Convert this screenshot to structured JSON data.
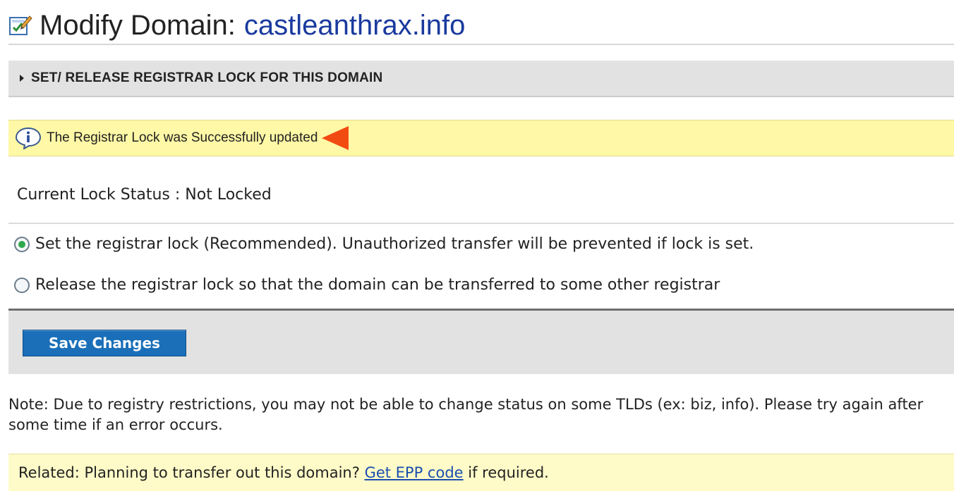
{
  "header": {
    "title_prefix": "Modify Domain:",
    "domain": "castleanthrax.info",
    "icon": "edit-document-icon"
  },
  "section": {
    "title": "SET/ RELEASE REGISTRAR LOCK FOR THIS DOMAIN"
  },
  "message": {
    "text": "The Registrar Lock was Successfully updated",
    "icon": "info-bubble-icon",
    "pointer_color": "#f24b12"
  },
  "lock": {
    "status_label": "Current Lock Status : Not Locked"
  },
  "options": [
    {
      "label": "Set the registrar lock (Recommended). Unauthorized transfer will be prevented if lock is set.",
      "checked": true
    },
    {
      "label": "Release the registrar lock so that the domain can be transferred to some other registrar",
      "checked": false
    }
  ],
  "actions": {
    "save_label": "Save Changes",
    "save_color": "#1a6fb8"
  },
  "note": {
    "text": "Note: Due to registry restrictions, you may not be able to change status on some TLDs (ex: biz, info). Please try again after some time if an error occurs."
  },
  "related": {
    "prefix": "Related: Planning to transfer out this domain?",
    "link_text": "Get EPP code",
    "suffix": "if required."
  }
}
